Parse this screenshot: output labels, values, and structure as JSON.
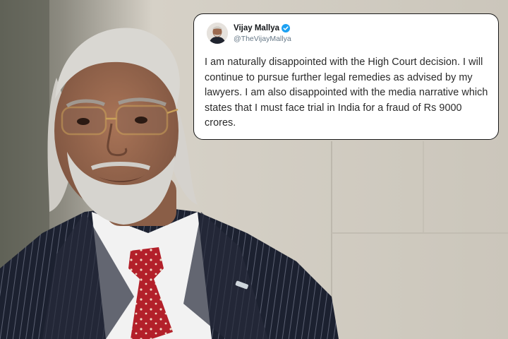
{
  "tweet": {
    "author_name": "Vijay Mallya",
    "author_handle": "@TheVijayMallya",
    "verified": true,
    "text": "I am naturally disappointed with the High Court decision. I will continue to pursue further legal remedies as advised by my lawyers. I am also disappointed with the media narrative which states that I must face trial in India for a fraud of Rs 9000 crores."
  },
  "photo": {
    "subject": "man-with-grey-hair-and-beard-in-pinstripe-suit",
    "colors": {
      "background_wall": "#d3cec4",
      "suit": "#1d2230",
      "shirt": "#f2f2f2",
      "tie": "#b3202a",
      "hair": "#d8d6d2",
      "skin": "#9a6a50"
    }
  },
  "colors": {
    "card_background": "#ffffff",
    "card_border": "#1a1a1a",
    "text_primary": "#2a2a2a",
    "handle_color": "#657786",
    "verified_blue": "#1da1f2"
  }
}
